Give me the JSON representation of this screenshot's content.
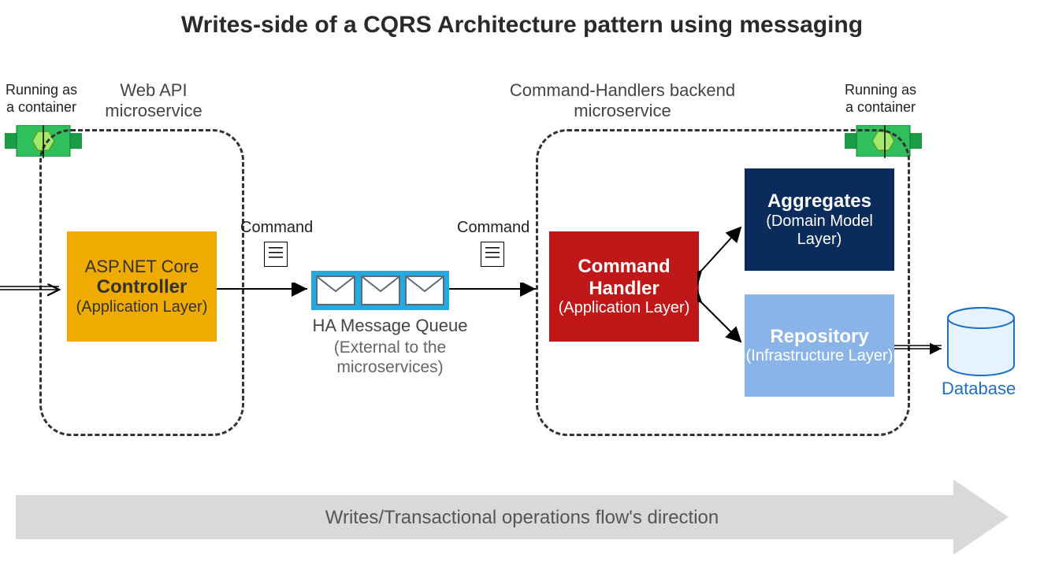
{
  "title": "Writes-side of a CQRS Architecture pattern using messaging",
  "containerLabel": "Running as a container",
  "webapi": {
    "label": "Web API microservice"
  },
  "backend": {
    "label": "Command-Handlers backend microservice"
  },
  "controller": {
    "title": "ASP.NET Core",
    "title2": "Controller",
    "sub": "(Application Layer)"
  },
  "commandLabel": "Command",
  "queue": {
    "title": "HA Message Queue",
    "sub": "(External to the microservices)"
  },
  "handler": {
    "title": "Command Handler",
    "sub": "(Application Layer)"
  },
  "aggregates": {
    "title": "Aggregates",
    "sub": "(Domain Model Layer)"
  },
  "repository": {
    "title": "Repository",
    "sub": "(Infrastructure Layer)"
  },
  "database": "Database",
  "flow": "Writes/Transactional operations flow's direction"
}
